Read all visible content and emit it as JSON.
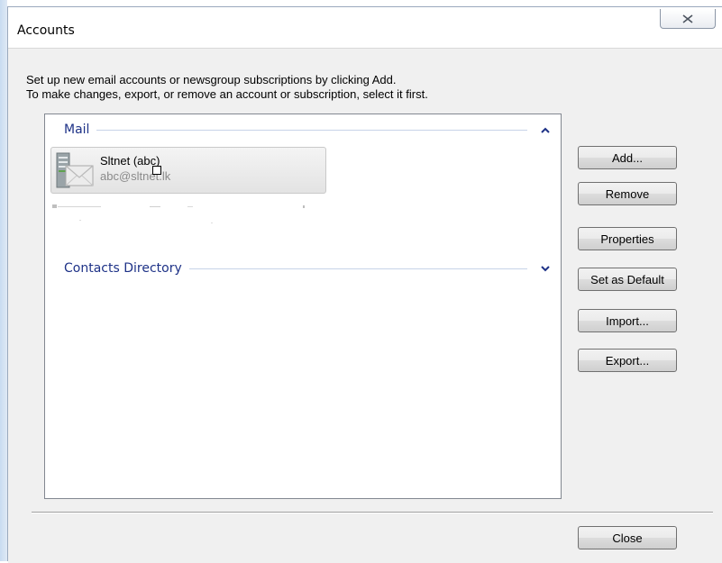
{
  "window": {
    "title": "Accounts"
  },
  "instructions": {
    "line1": "Set up new email accounts or newsgroup subscriptions by clicking Add.",
    "line2": "To make changes, export, or remove an account or subscription, select it first."
  },
  "list": {
    "mail_header": "Mail",
    "account": {
      "name": "Sltnet (abc)",
      "email": "abc@sltnet.lk"
    },
    "contacts_header": "Contacts Directory"
  },
  "buttons": {
    "add": "Add...",
    "remove": "Remove",
    "properties": "Properties",
    "set_default": "Set as Default",
    "import": "Import...",
    "export": "Export...",
    "close": "Close"
  },
  "colors": {
    "section_header": "#1e3287",
    "window_bg": "#f0f0f0"
  }
}
